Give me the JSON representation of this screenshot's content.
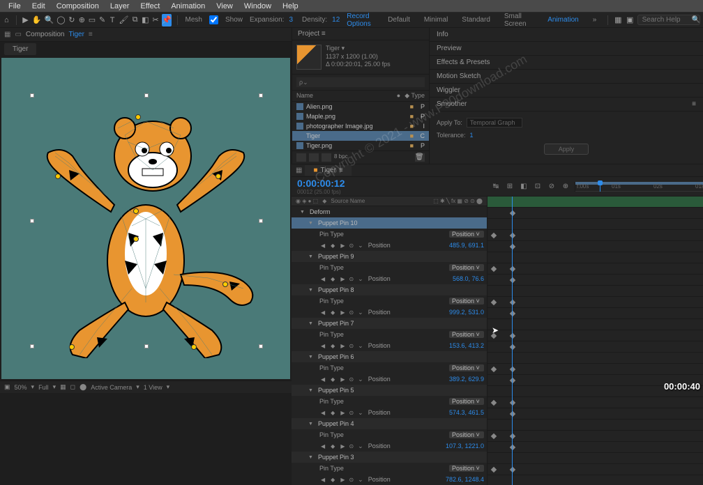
{
  "menu": [
    "File",
    "Edit",
    "Composition",
    "Layer",
    "Effect",
    "Animation",
    "View",
    "Window",
    "Help"
  ],
  "toolbar": {
    "mesh_label": "Mesh",
    "show_label": "Show",
    "expansion_label": "Expansion:",
    "expansion_value": "3",
    "density_label": "Density:",
    "density_value": "12",
    "record_options": "Record Options",
    "workspaces": [
      "Default",
      "Minimal",
      "Standard",
      "Small Screen",
      "Animation"
    ],
    "active_workspace": 4,
    "search_placeholder": "Search Help"
  },
  "comp_tab": {
    "prefix": "Composition",
    "name": "Tiger",
    "sub_tab": "Tiger"
  },
  "project": {
    "header": "Project",
    "item_name": "Tiger",
    "item_dims": "1137 x 1200 (1.00)",
    "item_dur": "Δ 0:00:20:01, 25.00 fps",
    "name_col": "Name",
    "type_col": "Type",
    "items": [
      {
        "name": "Alien.png",
        "type": "P"
      },
      {
        "name": "Maple.png",
        "type": "P"
      },
      {
        "name": "photographer Image.jpg",
        "type": "I"
      },
      {
        "name": "Tiger",
        "type": "C",
        "selected": true
      },
      {
        "name": "Tiger.png",
        "type": "P"
      }
    ]
  },
  "side_panels": [
    "Info",
    "Preview",
    "Effects & Presets",
    "Motion Sketch",
    "Wiggler",
    "Smoother"
  ],
  "smoother": {
    "apply_to": "Apply To:",
    "apply_value": "Temporal Graph",
    "tolerance": "Tolerance:",
    "tolerance_value": "1",
    "apply_btn": "Apply"
  },
  "timeline": {
    "tab": "Tiger",
    "timecode": "0:00:00:12",
    "timecode_sub": "00012 (25.00 fps)",
    "ruler": [
      "f:00s",
      "01s",
      "02s",
      "01s",
      "02s",
      "02s"
    ],
    "deform": "Deform",
    "pins": [
      {
        "name": "Puppet Pin 10",
        "pos": "485.9, 691.1",
        "selected": true
      },
      {
        "name": "Puppet Pin 9",
        "pos": "568.0, 76.6"
      },
      {
        "name": "Puppet Pin 8",
        "pos": "999.2, 531.0"
      },
      {
        "name": "Puppet Pin 7",
        "pos": "153.6, 413.2"
      },
      {
        "name": "Puppet Pin 6",
        "pos": "389.2, 629.9"
      },
      {
        "name": "Puppet Pin 5",
        "pos": "574.3, 461.5"
      },
      {
        "name": "Puppet Pin 4",
        "pos": "107.3, 1221.0"
      },
      {
        "name": "Puppet Pin 3",
        "pos": "782.6, 1248.4"
      }
    ],
    "pin_type": "Pin Type",
    "position_label": "Position",
    "source_name": "Source Name"
  },
  "bottom_bar": {
    "zoom": "50%",
    "full": "Full",
    "camera": "Active Camera",
    "view": "1 View"
  },
  "watermark": "Copyright © 2021 - www.P30download.com",
  "timestamp": "00:00:40"
}
